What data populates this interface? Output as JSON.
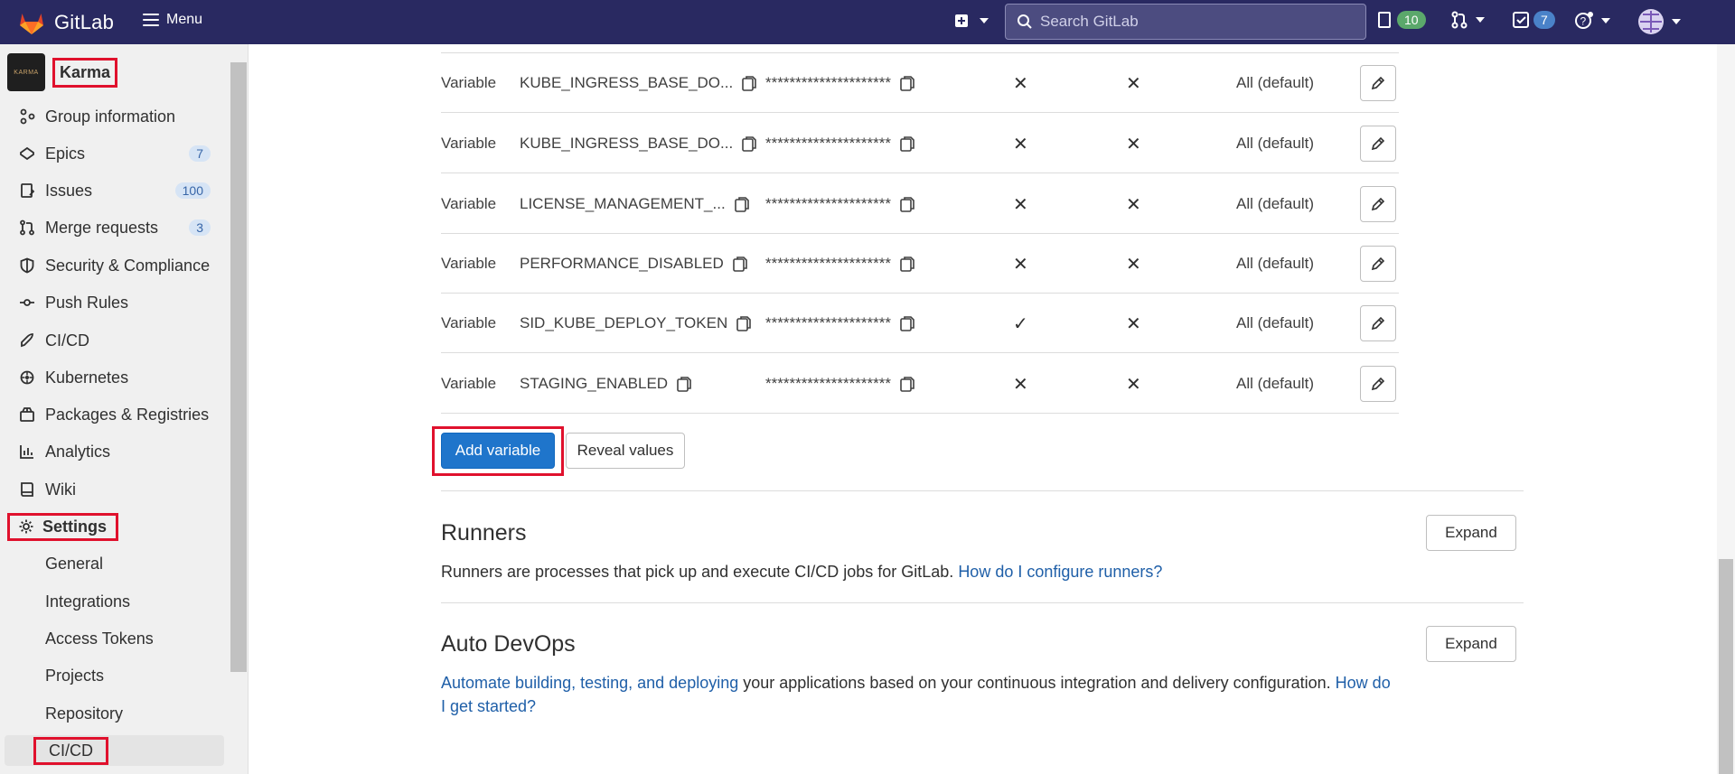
{
  "topbar": {
    "brand": "GitLab",
    "menu_label": "Menu",
    "search_placeholder": "Search GitLab",
    "issues_count": "10",
    "todos_count": "7"
  },
  "sidebar": {
    "group_name": "Karma",
    "avatar_text": "KARMA",
    "items": [
      {
        "label": "Group information"
      },
      {
        "label": "Epics",
        "badge": "7"
      },
      {
        "label": "Issues",
        "badge": "100"
      },
      {
        "label": "Merge requests",
        "badge": "3"
      },
      {
        "label": "Security & Compliance"
      },
      {
        "label": "Push Rules"
      },
      {
        "label": "CI/CD"
      },
      {
        "label": "Kubernetes"
      },
      {
        "label": "Packages & Registries"
      },
      {
        "label": "Analytics"
      },
      {
        "label": "Wiki"
      },
      {
        "label": "Settings"
      }
    ],
    "settings_sub": [
      {
        "label": "General"
      },
      {
        "label": "Integrations"
      },
      {
        "label": "Access Tokens"
      },
      {
        "label": "Projects"
      },
      {
        "label": "Repository"
      },
      {
        "label": "CI/CD"
      }
    ]
  },
  "variables": {
    "rows": [
      {
        "type": "Variable",
        "key": "KUBE_INGRESS_BASE_DO...",
        "value": "*********************",
        "protected": "✕",
        "masked": "✕",
        "scope": "All (default)"
      },
      {
        "type": "Variable",
        "key": "KUBE_INGRESS_BASE_DO...",
        "value": "*********************",
        "protected": "✕",
        "masked": "✕",
        "scope": "All (default)"
      },
      {
        "type": "Variable",
        "key": "LICENSE_MANAGEMENT_...",
        "value": "*********************",
        "protected": "✕",
        "masked": "✕",
        "scope": "All (default)"
      },
      {
        "type": "Variable",
        "key": "PERFORMANCE_DISABLED",
        "value": "*********************",
        "protected": "✕",
        "masked": "✕",
        "scope": "All (default)"
      },
      {
        "type": "Variable",
        "key": "SID_KUBE_DEPLOY_TOKEN",
        "value": "*********************",
        "protected": "✓",
        "masked": "✕",
        "scope": "All (default)"
      },
      {
        "type": "Variable",
        "key": "STAGING_ENABLED",
        "value": "*********************",
        "protected": "✕",
        "masked": "✕",
        "scope": "All (default)"
      }
    ],
    "add_label": "Add variable",
    "reveal_label": "Reveal values"
  },
  "runners": {
    "title": "Runners",
    "desc": "Runners are processes that pick up and execute CI/CD jobs for GitLab.",
    "link": "How do I configure runners?",
    "expand": "Expand"
  },
  "autodevops": {
    "title": "Auto DevOps",
    "link1": "Automate building, testing, and deploying",
    "desc": " your applications based on your continuous integration and delivery configuration.",
    "link2": "How do I get started?",
    "expand": "Expand"
  }
}
